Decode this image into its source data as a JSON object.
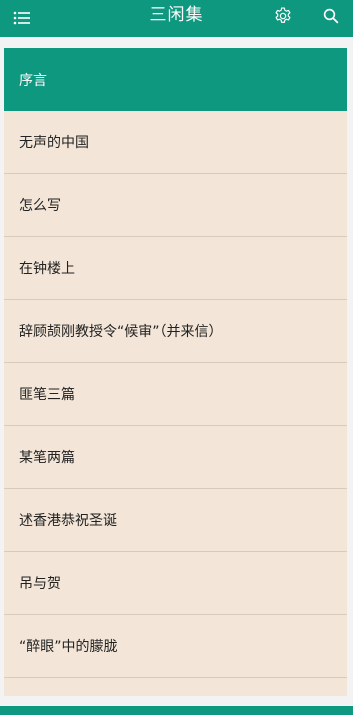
{
  "header": {
    "title": "三闲集",
    "menu_icon": "menu-icon",
    "settings_icon": "gear-icon",
    "search_icon": "search-icon"
  },
  "colors": {
    "primary": "#0f9880",
    "list_bg": "#f3e6d8",
    "divider": "#d8cbbd",
    "text": "#222222"
  },
  "chapters": [
    {
      "label": "序言",
      "selected": true
    },
    {
      "label": "无声的中国",
      "selected": false
    },
    {
      "label": "怎么写",
      "selected": false
    },
    {
      "label": "在钟楼上",
      "selected": false
    },
    {
      "label": "辞顾颉刚教授令“候审”（并来信）",
      "selected": false
    },
    {
      "label": "匪笔三篇",
      "selected": false
    },
    {
      "label": "某笔两篇",
      "selected": false
    },
    {
      "label": "述香港恭祝圣诞",
      "selected": false
    },
    {
      "label": "吊与贺",
      "selected": false
    },
    {
      "label": "“醉眼”中的朦胧",
      "selected": false
    }
  ]
}
